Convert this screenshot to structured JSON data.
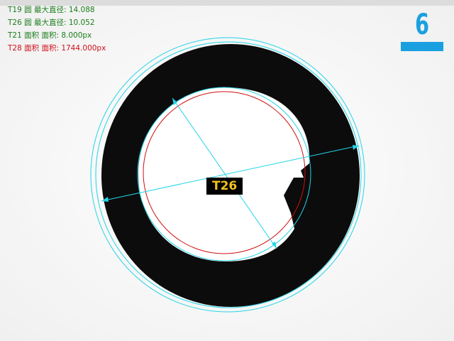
{
  "results": [
    {
      "text": "T19 圆 最大直径: 14.088",
      "color": "#1b7d1b"
    },
    {
      "text": "T26 圆 最大直径: 10.052",
      "color": "#1b7d1b"
    },
    {
      "text": "T21 面积 面积: 8.000px",
      "color": "#1b7d1b"
    },
    {
      "text": "T28 面积 面积: 1744.000px",
      "color": "#d0101a"
    }
  ],
  "indicator": {
    "value": "6",
    "color": "#1aa0e0"
  },
  "tool_label": {
    "text": "T26",
    "color": "#f0c020"
  },
  "colors": {
    "overlay_cyan": "#22d4e6",
    "fit_red": "#cc1010"
  }
}
